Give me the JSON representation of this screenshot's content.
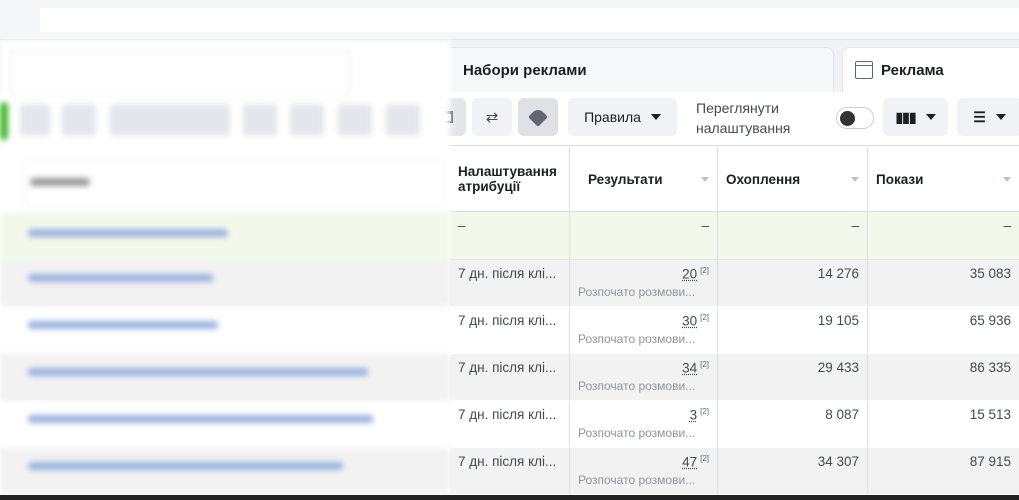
{
  "tabs": [
    {
      "label": "Набори реклами",
      "icon": "ad-sets-icon"
    },
    {
      "label": "Реклама",
      "icon": "window-icon"
    }
  ],
  "toolbar": {
    "rules_label": "Правила",
    "view_settings_label": "Переглянути налаштування",
    "toggle_on": false,
    "icons": [
      "trash-icon",
      "duplicate-icon",
      "tag-icon",
      "columns-icon",
      "breakdown-icon"
    ]
  },
  "table": {
    "headers": [
      "Налаштування атрибуції",
      "Результати",
      "Охоплення",
      "Покази"
    ],
    "total": [
      "–",
      "–",
      "–",
      "–"
    ],
    "rows": [
      {
        "attribution": "7 дн. після клі...",
        "results": "20",
        "results_note": "[2]",
        "results_type": "Розпочато розмови...",
        "reach": "14 276",
        "impressions": "35 083"
      },
      {
        "attribution": "7 дн. після клі...",
        "results": "30",
        "results_note": "[2]",
        "results_type": "Розпочато розмови...",
        "reach": "19 105",
        "impressions": "65 936"
      },
      {
        "attribution": "7 дн. після клі...",
        "results": "34",
        "results_note": "[2]",
        "results_type": "Розпочато розмови...",
        "reach": "29 433",
        "impressions": "86 335"
      },
      {
        "attribution": "7 дн. після клі...",
        "results": "3",
        "results_note": "[2]",
        "results_type": "Розпочато розмови...",
        "reach": "8 087",
        "impressions": "15 513"
      },
      {
        "attribution": "7 дн. після клі...",
        "results": "47",
        "results_note": "[2]",
        "results_type": "Розпочато розмови...",
        "reach": "34 307",
        "impressions": "87 915"
      }
    ]
  }
}
